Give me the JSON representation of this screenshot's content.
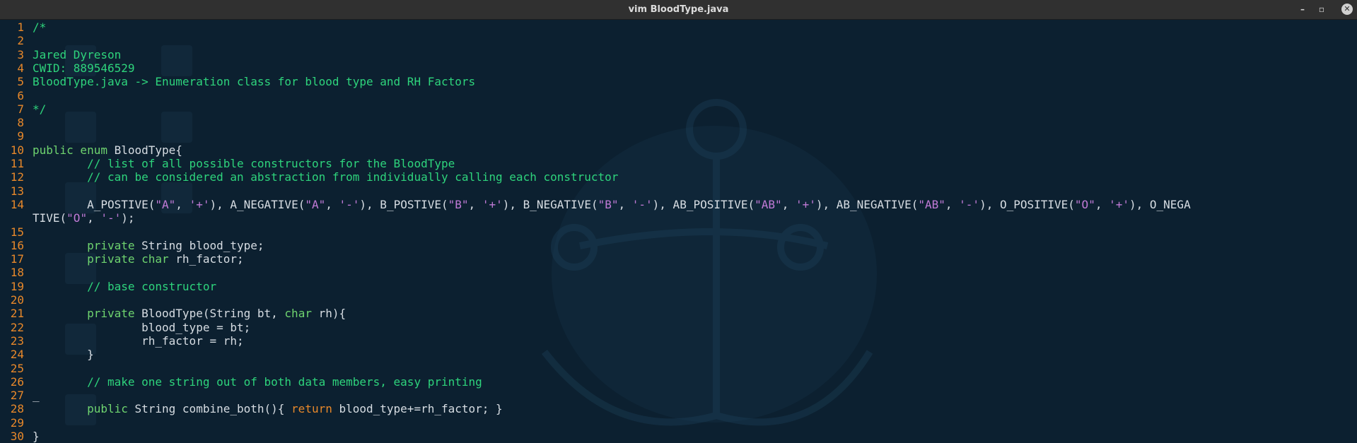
{
  "window": {
    "title": "vim BloodType.java",
    "controls": {
      "minimize": "–",
      "maximize": "▫",
      "close": "✕"
    }
  },
  "editor": {
    "lines": [
      {
        "n": "1",
        "segments": [
          {
            "t": "/*",
            "c": "cmt"
          }
        ]
      },
      {
        "n": "2",
        "segments": []
      },
      {
        "n": "3",
        "segments": [
          {
            "t": "Jared Dyreson",
            "c": "cmt"
          }
        ]
      },
      {
        "n": "4",
        "segments": [
          {
            "t": "CWID: 889546529",
            "c": "cmt"
          }
        ]
      },
      {
        "n": "5",
        "segments": [
          {
            "t": "BloodType.java -> Enumeration class for blood type and RH Factors",
            "c": "cmt"
          }
        ]
      },
      {
        "n": "6",
        "segments": []
      },
      {
        "n": "7",
        "segments": [
          {
            "t": "*/",
            "c": "cmt"
          }
        ]
      },
      {
        "n": "8",
        "segments": []
      },
      {
        "n": "9",
        "segments": []
      },
      {
        "n": "10",
        "segments": [
          {
            "t": "public enum",
            "c": "kw"
          },
          {
            "t": " BloodType{",
            "c": ""
          }
        ]
      },
      {
        "n": "11",
        "segments": [
          {
            "t": "        // list of all possible constructors for the BloodType",
            "c": "cmt"
          }
        ]
      },
      {
        "n": "12",
        "segments": [
          {
            "t": "        // can be considered an abstraction from individually calling each constructor",
            "c": "cmt"
          }
        ]
      },
      {
        "n": "13",
        "segments": []
      },
      {
        "n": "14",
        "segments": [
          {
            "t": "        A_POSTIVE(",
            "c": ""
          },
          {
            "t": "\"A\"",
            "c": "str"
          },
          {
            "t": ", ",
            "c": ""
          },
          {
            "t": "'+'",
            "c": "str"
          },
          {
            "t": "), A_NEGATIVE(",
            "c": ""
          },
          {
            "t": "\"A\"",
            "c": "str"
          },
          {
            "t": ", ",
            "c": ""
          },
          {
            "t": "'-'",
            "c": "str"
          },
          {
            "t": "), B_POSTIVE(",
            "c": ""
          },
          {
            "t": "\"B\"",
            "c": "str"
          },
          {
            "t": ", ",
            "c": ""
          },
          {
            "t": "'+'",
            "c": "str"
          },
          {
            "t": "), B_NEGATIVE(",
            "c": ""
          },
          {
            "t": "\"B\"",
            "c": "str"
          },
          {
            "t": ", ",
            "c": ""
          },
          {
            "t": "'-'",
            "c": "str"
          },
          {
            "t": "), AB_POSITIVE(",
            "c": ""
          },
          {
            "t": "\"AB\"",
            "c": "str"
          },
          {
            "t": ", ",
            "c": ""
          },
          {
            "t": "'+'",
            "c": "str"
          },
          {
            "t": "), AB_NEGATIVE(",
            "c": ""
          },
          {
            "t": "\"AB\"",
            "c": "str"
          },
          {
            "t": ", ",
            "c": ""
          },
          {
            "t": "'-'",
            "c": "str"
          },
          {
            "t": "), O_POSITIVE(",
            "c": ""
          },
          {
            "t": "\"O\"",
            "c": "str"
          },
          {
            "t": ", ",
            "c": ""
          },
          {
            "t": "'+'",
            "c": "str"
          },
          {
            "t": "), O_NEGA",
            "c": ""
          }
        ]
      },
      {
        "n": "",
        "segments": [
          {
            "t": "TIVE(",
            "c": ""
          },
          {
            "t": "\"O\"",
            "c": "str"
          },
          {
            "t": ", ",
            "c": ""
          },
          {
            "t": "'-'",
            "c": "str"
          },
          {
            "t": ");",
            "c": ""
          }
        ]
      },
      {
        "n": "15",
        "segments": []
      },
      {
        "n": "16",
        "segments": [
          {
            "t": "        private",
            "c": "kw"
          },
          {
            "t": " String blood_type;",
            "c": ""
          }
        ]
      },
      {
        "n": "17",
        "segments": [
          {
            "t": "        private char",
            "c": "kw"
          },
          {
            "t": " rh_factor;",
            "c": ""
          }
        ]
      },
      {
        "n": "18",
        "segments": []
      },
      {
        "n": "19",
        "segments": [
          {
            "t": "        // base constructor",
            "c": "cmt"
          }
        ]
      },
      {
        "n": "20",
        "segments": []
      },
      {
        "n": "21",
        "segments": [
          {
            "t": "        private",
            "c": "kw"
          },
          {
            "t": " BloodType(String bt, ",
            "c": ""
          },
          {
            "t": "char",
            "c": "kw"
          },
          {
            "t": " rh){",
            "c": ""
          }
        ]
      },
      {
        "n": "22",
        "segments": [
          {
            "t": "                blood_type = bt;",
            "c": ""
          }
        ]
      },
      {
        "n": "23",
        "segments": [
          {
            "t": "                rh_factor = rh;",
            "c": ""
          }
        ]
      },
      {
        "n": "24",
        "segments": [
          {
            "t": "        }",
            "c": ""
          }
        ]
      },
      {
        "n": "25",
        "segments": []
      },
      {
        "n": "26",
        "segments": [
          {
            "t": "        // make one string out of both data members, easy printing",
            "c": "cmt"
          }
        ]
      },
      {
        "n": "27",
        "segments": [
          {
            "t": "_",
            "c": ""
          }
        ]
      },
      {
        "n": "28",
        "segments": [
          {
            "t": "        public",
            "c": "kw"
          },
          {
            "t": " String combine_both(){ ",
            "c": ""
          },
          {
            "t": "return",
            "c": "ret"
          },
          {
            "t": " blood_type+=rh_factor; }",
            "c": ""
          }
        ]
      },
      {
        "n": "29",
        "segments": []
      },
      {
        "n": "30",
        "segments": [
          {
            "t": "}",
            "c": ""
          }
        ]
      }
    ]
  },
  "colors": {
    "background": "#0c2030",
    "line_numbers": "#e8882a",
    "comment": "#2ed47c",
    "keyword": "#6fd46f",
    "string": "#c07ad6",
    "text": "#d7dde3"
  }
}
